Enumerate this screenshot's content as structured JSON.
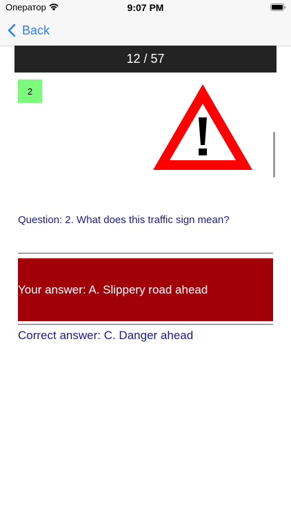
{
  "status_bar": {
    "carrier": "Оператор",
    "time": "9:07 PM",
    "wifi_icon": "wifi-icon",
    "battery_icon": "battery-icon"
  },
  "nav": {
    "back_label": "Back",
    "back_icon": "chevron-left-icon"
  },
  "quiz": {
    "counter": "12 / 57",
    "question_number": "2",
    "sign_icon": "warning-triangle-icon",
    "question": "Question: 2. What does this traffic sign mean?",
    "your_answer": "Your answer: A. Slippery road ahead",
    "correct_answer": "Correct answer: C. Danger ahead"
  },
  "colors": {
    "accent": "#2f80ed",
    "header_bg": "#232323",
    "badge_bg": "#7dfa7d",
    "wrong_answer_bg": "#a10008",
    "question_text": "#1a1a8c",
    "sign_red": "#ff0000"
  }
}
